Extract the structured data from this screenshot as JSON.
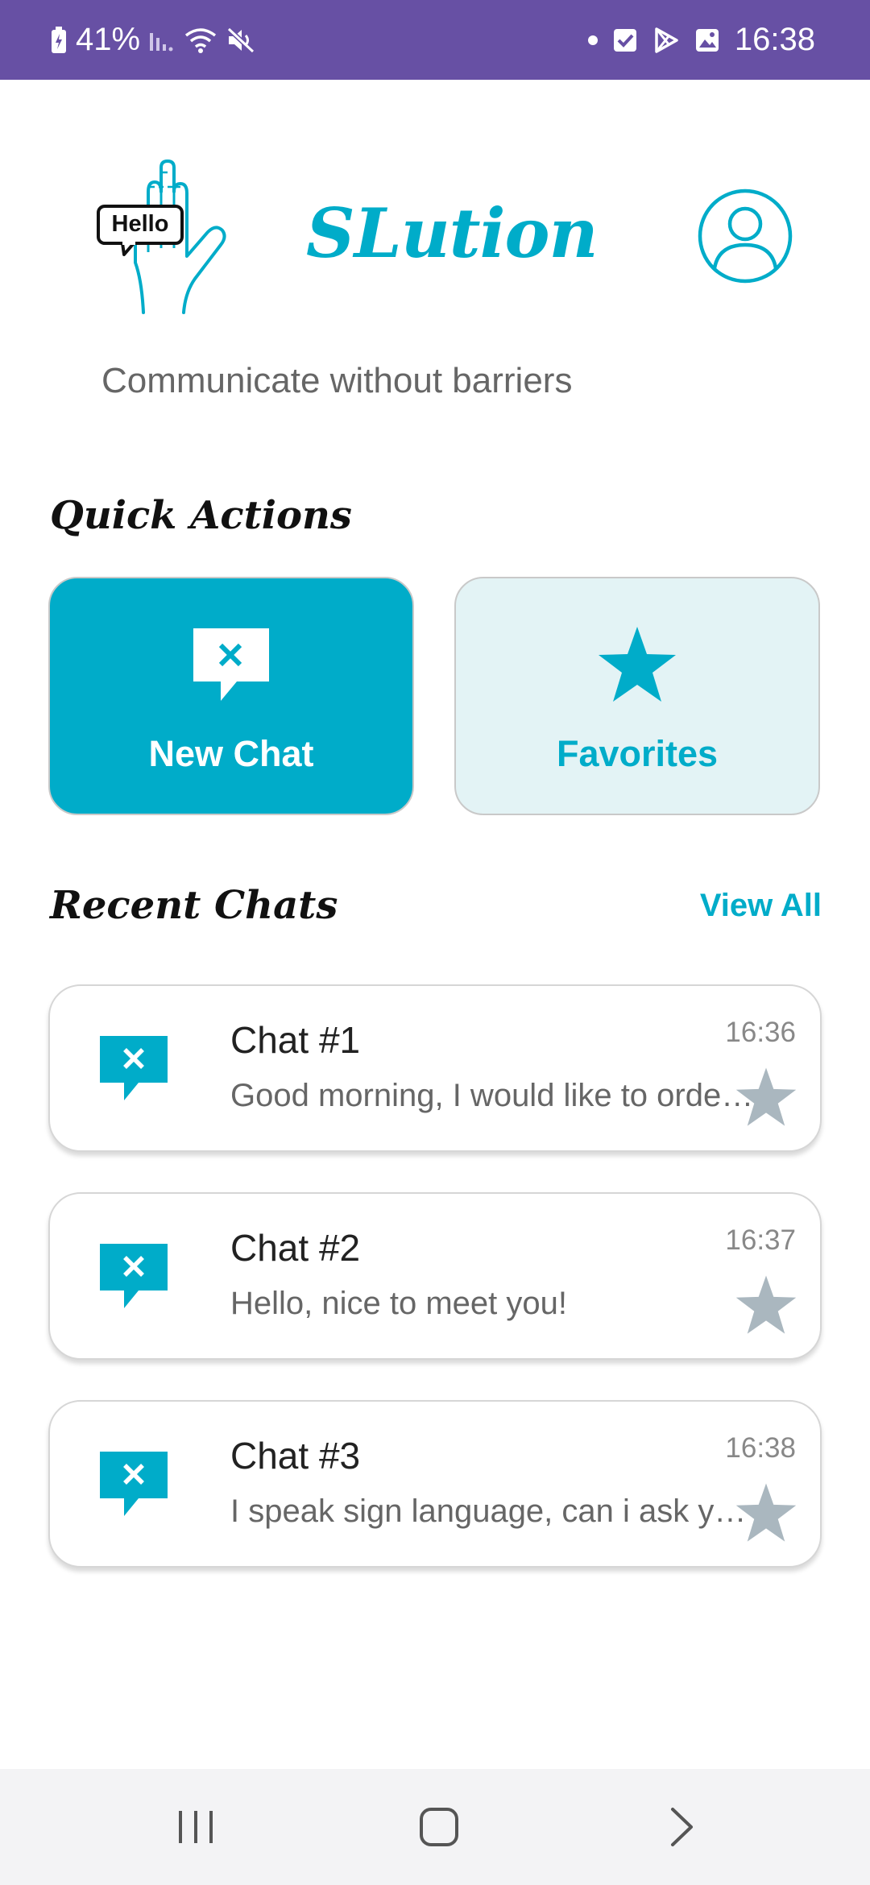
{
  "status_bar": {
    "battery": "41%",
    "time": "16:38",
    "background": "#6750a4"
  },
  "header": {
    "logo_bubble_text": "Hello",
    "app_title": "SLution",
    "tagline": "Communicate without barriers",
    "accent": "#00acc9"
  },
  "quick_actions": {
    "heading": "Quick Actions",
    "new_chat_label": "New Chat",
    "favorites_label": "Favorites"
  },
  "recent_chats": {
    "heading": "Recent Chats",
    "view_all_label": "View All",
    "items": [
      {
        "title": "Chat #1",
        "preview": "Good morning, I would like to order a coffee please",
        "time": "16:36",
        "favorite": false
      },
      {
        "title": "Chat #2",
        "preview": "Hello, nice to meet you!",
        "time": "16:37",
        "favorite": false
      },
      {
        "title": "Chat #3",
        "preview": "I speak sign language, can i ask you something?",
        "time": "16:38",
        "favorite": false
      }
    ]
  },
  "icons": {
    "chat": "chat-bubble-x-icon",
    "star": "star-icon",
    "profile": "user-circle-icon"
  }
}
